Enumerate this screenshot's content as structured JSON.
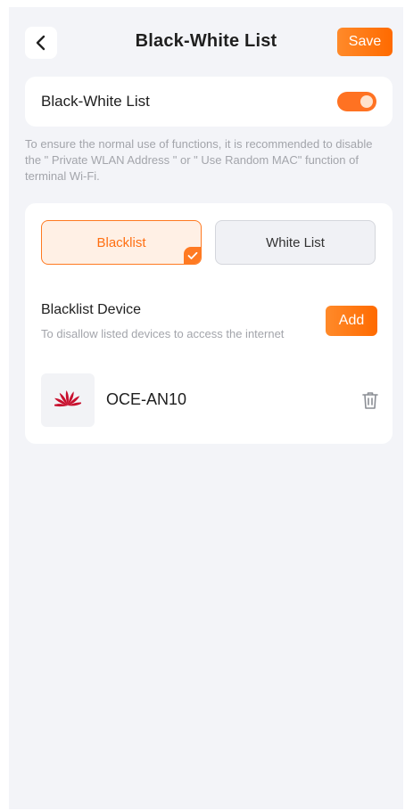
{
  "header": {
    "title": "Black-White List",
    "save_label": "Save",
    "back_icon": "chevron-left-icon"
  },
  "toggle_card": {
    "label": "Black-White List",
    "enabled": true
  },
  "note": "To ensure the normal use of functions, it is recommended to disable the \" Private WLAN Address \" or \" Use Random MAC\" function of terminal Wi-Fi.",
  "mode": {
    "selected": "Blacklist",
    "options": [
      "Blacklist",
      "White List"
    ]
  },
  "section": {
    "title": "Blacklist Device",
    "subtitle": "To disallow listed devices to access the internet",
    "add_label": "Add"
  },
  "devices": [
    {
      "name": "OCE-AN10",
      "logo": "huawei-logo",
      "action_icon": "trash-icon"
    }
  ],
  "colors": {
    "accent": "#ff7222",
    "background": "#f3f4f8",
    "card": "#ffffff",
    "muted_text": "#a3a5ab",
    "brand_logo": "#c8102e"
  }
}
